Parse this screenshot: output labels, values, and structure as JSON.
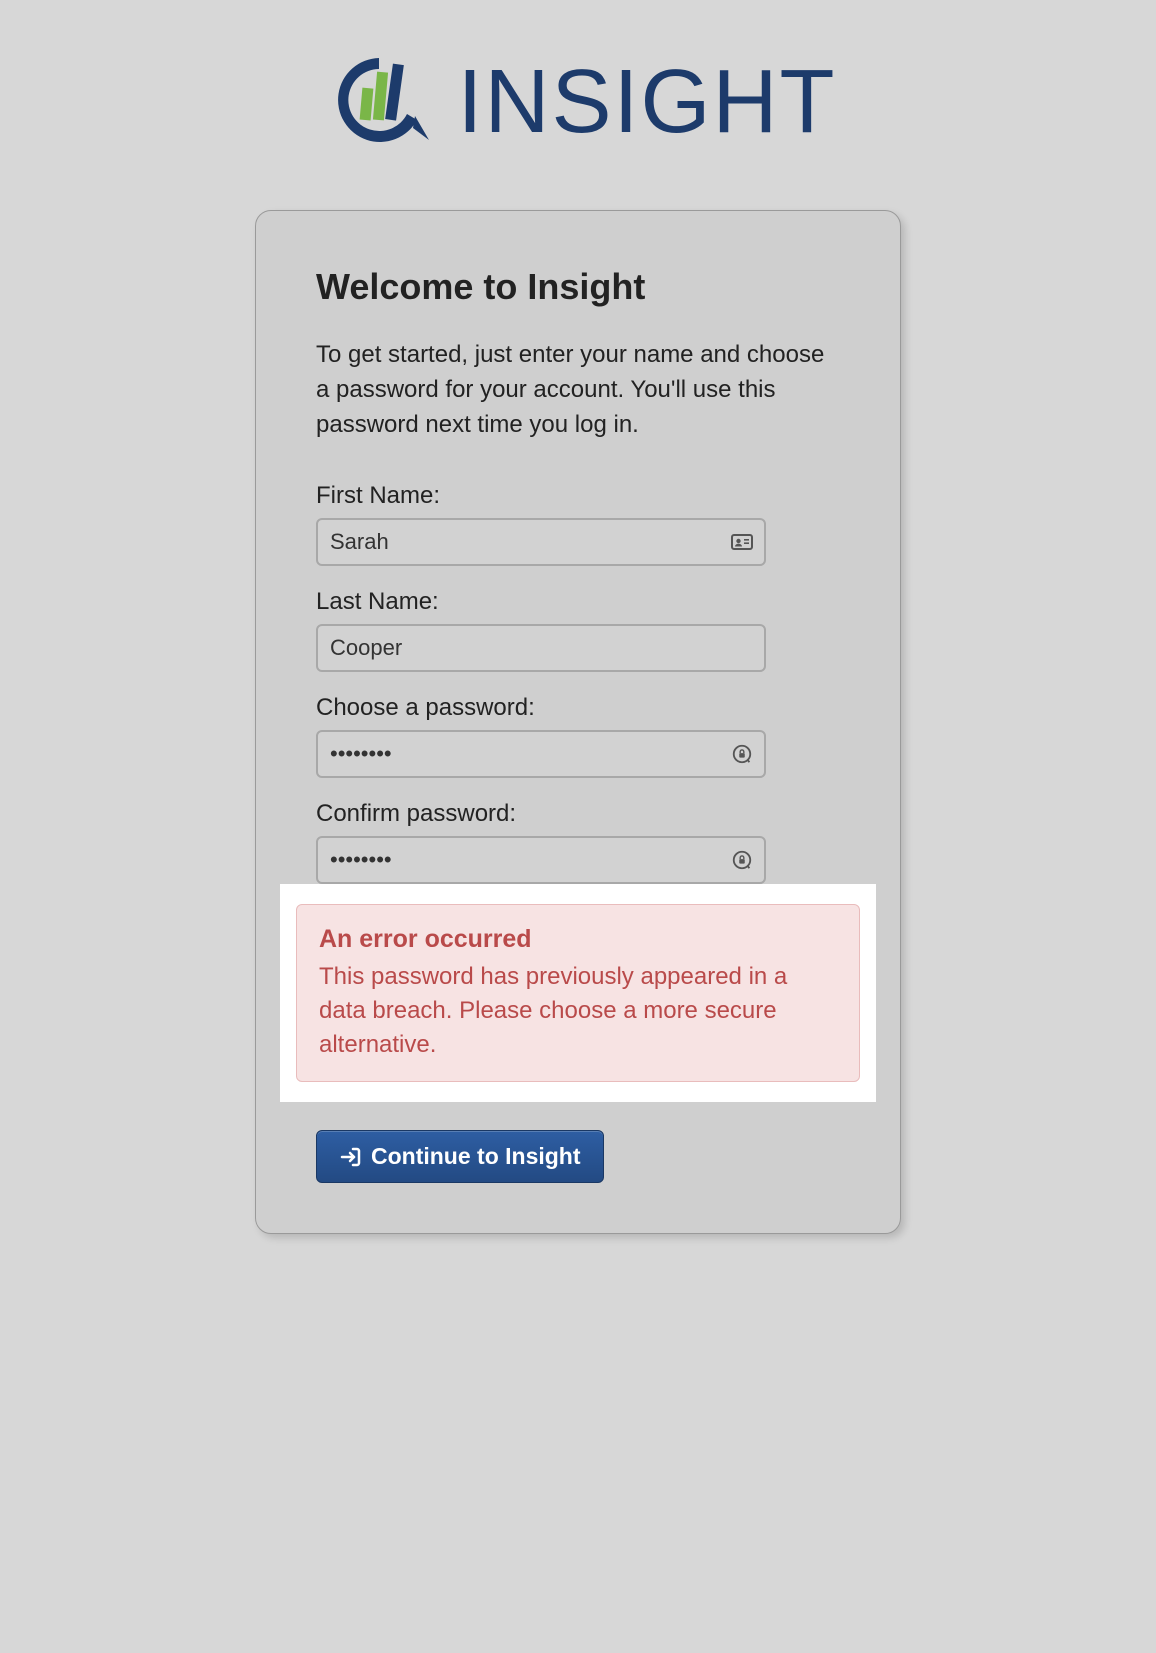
{
  "brand": {
    "name": "INSIGHT"
  },
  "card": {
    "heading": "Welcome to Insight",
    "intro": "To get started, just enter your name and choose a password for your account. You'll use this password next time you log in."
  },
  "form": {
    "first_name": {
      "label": "First Name:",
      "value": "Sarah"
    },
    "last_name": {
      "label": "Last Name:",
      "value": "Cooper"
    },
    "password": {
      "label": "Choose a password:",
      "value": "••••••••"
    },
    "confirm": {
      "label": "Confirm password:",
      "value": "••••••••"
    }
  },
  "error": {
    "title": "An error occurred",
    "body": "This password has previously appeared in a data breach. Please choose a more secure alternative."
  },
  "submit": {
    "label": "Continue to Insight"
  }
}
